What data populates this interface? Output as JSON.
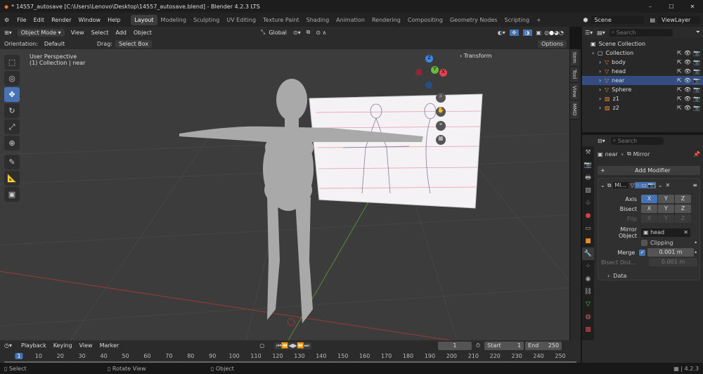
{
  "title": "* 14557_autosave [C:\\Users\\Lenovo\\Desktop\\14557_autosave.blend] - Blender 4.2.3 LTS",
  "window_controls": [
    "–",
    "☐",
    "✕"
  ],
  "menus": [
    "File",
    "Edit",
    "Render",
    "Window",
    "Help"
  ],
  "workspaces": [
    "Layout",
    "Modeling",
    "Sculpting",
    "UV Editing",
    "Texture Paint",
    "Shading",
    "Animation",
    "Rendering",
    "Compositing",
    "Geometry Nodes",
    "Scripting",
    "+"
  ],
  "active_workspace": "Layout",
  "scene": "Scene",
  "view_layer": "ViewLayer",
  "viewport": {
    "mode": "Object Mode",
    "menus": [
      "View",
      "Select",
      "Add",
      "Object"
    ],
    "transform_orientation": "Global",
    "orientation_label": "Orientation:",
    "orientation": "Default",
    "drag_label": "Drag:",
    "drag": "Select Box",
    "options": "Options",
    "overlay_line1": "User Perspective",
    "overlay_line2": "(1) Collection | near",
    "transform_panel": "Transform",
    "gizmo": {
      "x": "X",
      "y": "Y",
      "z": "Z"
    },
    "side_tabs": [
      "Item",
      "Tool",
      "View",
      "MMD"
    ],
    "tools": [
      "select-box",
      "cursor",
      "move",
      "rotate",
      "scale",
      "transform",
      "annotate",
      "measure",
      "add-cube"
    ],
    "active_tool": "move"
  },
  "outliner": {
    "search_placeholder": "Search",
    "items": [
      {
        "label": "Scene Collection",
        "level": 0
      },
      {
        "label": "Collection",
        "level": 1
      },
      {
        "label": "body",
        "level": 2
      },
      {
        "label": "head",
        "level": 2
      },
      {
        "label": "near",
        "level": 2
      },
      {
        "label": "Sphere",
        "level": 2
      },
      {
        "label": "z1",
        "level": 2
      },
      {
        "label": "z2",
        "level": 2
      }
    ]
  },
  "properties": {
    "search_placeholder": "Search",
    "breadcrumb": [
      "near",
      "Mirror"
    ],
    "add_modifier": "Add Modifier",
    "modifier_name": "Mi...",
    "axis_label": "Axis",
    "bisect_label": "Bisect",
    "flip_label": "Flip",
    "axes": [
      "X",
      "Y",
      "Z"
    ],
    "axis_active": "X",
    "mirror_object_label": "Mirror Object",
    "mirror_object": "head",
    "clipping": "Clipping",
    "clipping_checked": false,
    "merge_label": "Merge",
    "merge_checked": true,
    "merge_value": "0.001 m",
    "bisect_dist_label": "Bisect Dist...",
    "bisect_dist_value": "0.001 m",
    "data_panel": "Data"
  },
  "timeline": {
    "menus": [
      "Playback",
      "Keying",
      "View",
      "Marker"
    ],
    "current_frame": "1",
    "start_label": "Start",
    "start": "1",
    "end_label": "End",
    "end": "250",
    "ticks": [
      "1",
      "10",
      "20",
      "30",
      "40",
      "50",
      "60",
      "70",
      "80",
      "90",
      "100",
      "110",
      "120",
      "130",
      "140",
      "150",
      "160",
      "170",
      "180",
      "190",
      "200",
      "210",
      "220",
      "230",
      "240",
      "250"
    ]
  },
  "status": {
    "select": "Select",
    "rotate": "Rotate View",
    "object": "Object",
    "version": "4.2.3"
  },
  "colors": {
    "accent": "#4772b3",
    "x_axis": "#e8414f",
    "y_axis": "#6bb83a",
    "z_axis": "#3f86e0",
    "viewport_bg": "#3c3c3c"
  }
}
